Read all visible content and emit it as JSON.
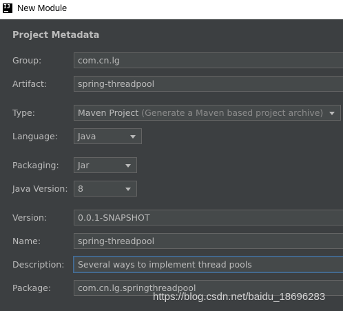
{
  "window": {
    "title": "New Module",
    "app_icon": "IJ"
  },
  "section": {
    "title": "Project Metadata"
  },
  "fields": {
    "group": {
      "label": "Group:",
      "value": "com.cn.lg"
    },
    "artifact": {
      "label": "Artifact:",
      "value": "spring-threadpool"
    },
    "type": {
      "label": "Type:",
      "value": "Maven Project",
      "hint": "(Generate a Maven based project archive)"
    },
    "language": {
      "label": "Language:",
      "value": "Java"
    },
    "packaging": {
      "label": "Packaging:",
      "value": "Jar"
    },
    "java_version": {
      "label": "Java Version:",
      "value": "8"
    },
    "version": {
      "label": "Version:",
      "value": "0.0.1-SNAPSHOT"
    },
    "name": {
      "label": "Name:",
      "value": "spring-threadpool"
    },
    "description": {
      "label": "Description:",
      "value": "Several ways to implement thread pools"
    },
    "package": {
      "label": "Package:",
      "value": "com.cn.lg.springthreadpool"
    }
  },
  "watermark": "https://blog.csdn.net/baidu_18696283"
}
